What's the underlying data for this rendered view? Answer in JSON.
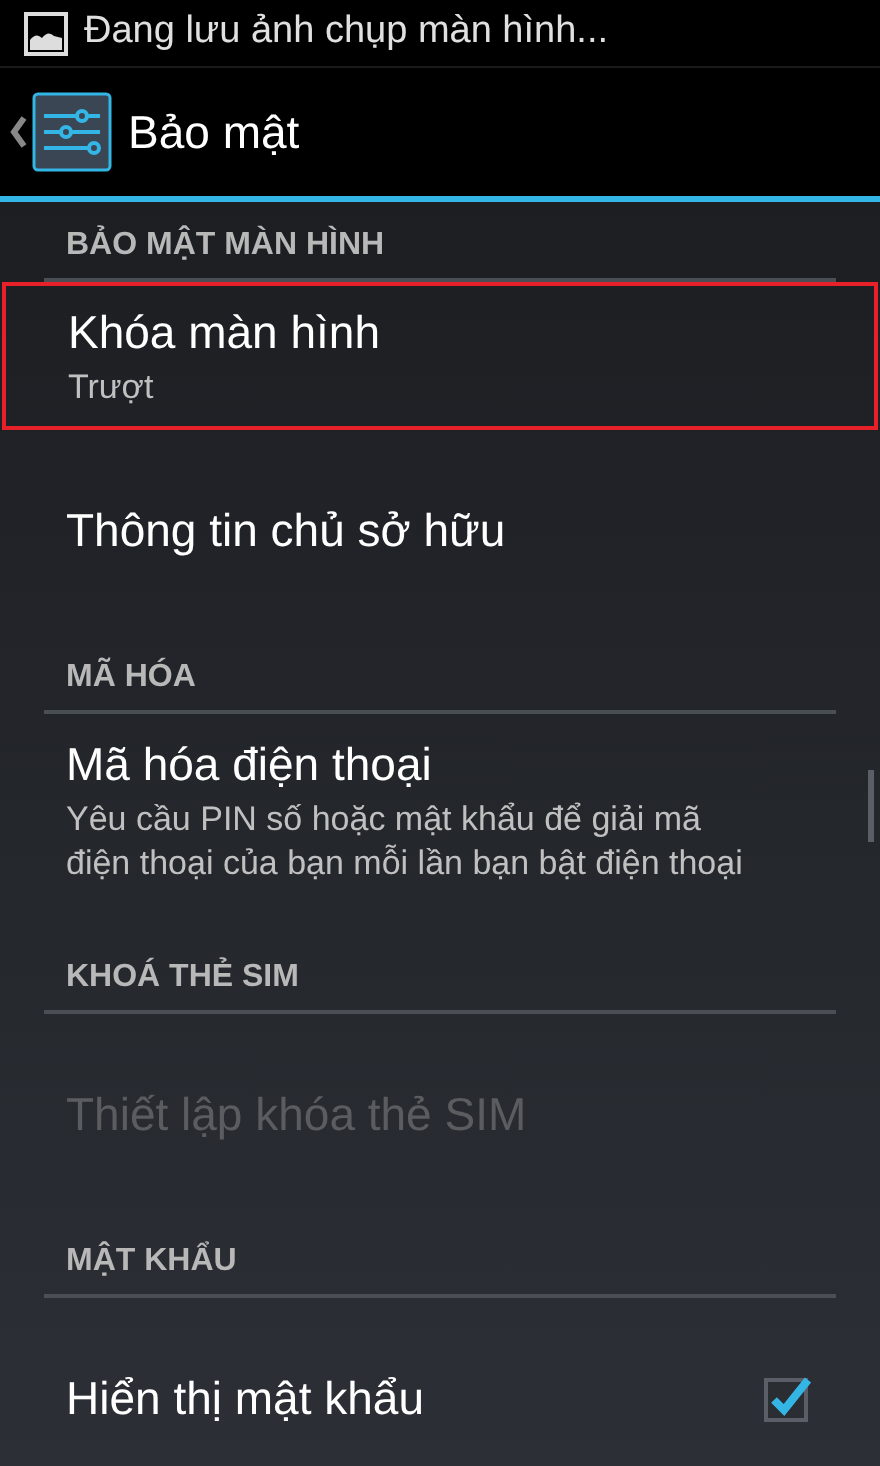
{
  "status_bar": {
    "notification": "Đang lưu ảnh chụp màn hình..."
  },
  "action_bar": {
    "title": "Bảo mật"
  },
  "list": [
    {
      "kind": "header",
      "title": "BẢO MẬT MÀN HÌNH"
    },
    {
      "kind": "item",
      "title": "Khóa màn hình",
      "summary": "Trượt",
      "highlighted": true,
      "disabled": false
    },
    {
      "kind": "item",
      "title": "Thông tin chủ sở hữu",
      "highlighted": false,
      "disabled": false
    },
    {
      "kind": "header",
      "title": "MÃ HÓA"
    },
    {
      "kind": "item",
      "title": "Mã hóa điện thoại",
      "summary": "Yêu cầu PIN số hoặc mật khẩu để giải mã điện thoại của bạn mỗi lần bạn bật điện thoại",
      "highlighted": false,
      "disabled": false
    },
    {
      "kind": "header",
      "title": "KHOÁ THẺ SIM"
    },
    {
      "kind": "item",
      "title": "Thiết lập khóa thẻ SIM",
      "highlighted": false,
      "disabled": true
    },
    {
      "kind": "header",
      "title": "MẬT KHẨU"
    },
    {
      "kind": "checkbox",
      "title": "Hiển thị mật khẩu",
      "checked": true,
      "disabled": false
    }
  ]
}
